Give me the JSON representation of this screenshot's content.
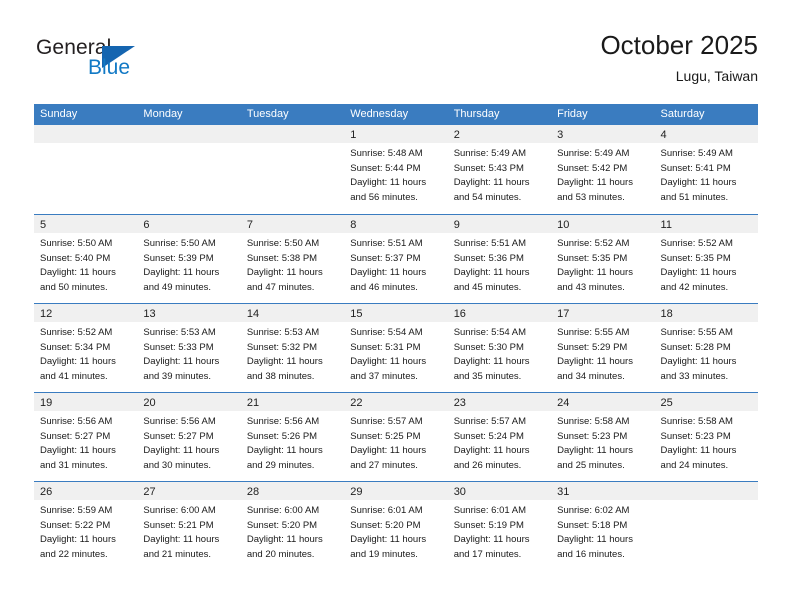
{
  "logo": {
    "word_top": "General",
    "word_bottom": "Blue",
    "accent_color": "#1565b0",
    "text_color": "#231f20"
  },
  "header": {
    "title": "October 2025",
    "subtitle": "Lugu, Taiwan"
  },
  "theme": {
    "header_row_bg": "#3a7cc0",
    "header_row_text": "#ffffff",
    "day_head_bg": "#f0f0f0",
    "row_divider": "#3a7cc0"
  },
  "weekday_headers": [
    "Sunday",
    "Monday",
    "Tuesday",
    "Wednesday",
    "Thursday",
    "Friday",
    "Saturday"
  ],
  "weeks": [
    [
      {
        "day": "",
        "sunrise": "",
        "sunset": "",
        "daylight_1": "",
        "daylight_2": "",
        "empty": true
      },
      {
        "day": "",
        "sunrise": "",
        "sunset": "",
        "daylight_1": "",
        "daylight_2": "",
        "empty": true
      },
      {
        "day": "",
        "sunrise": "",
        "sunset": "",
        "daylight_1": "",
        "daylight_2": "",
        "empty": true
      },
      {
        "day": "1",
        "sunrise": "Sunrise: 5:48 AM",
        "sunset": "Sunset: 5:44 PM",
        "daylight_1": "Daylight: 11 hours",
        "daylight_2": "and 56 minutes."
      },
      {
        "day": "2",
        "sunrise": "Sunrise: 5:49 AM",
        "sunset": "Sunset: 5:43 PM",
        "daylight_1": "Daylight: 11 hours",
        "daylight_2": "and 54 minutes."
      },
      {
        "day": "3",
        "sunrise": "Sunrise: 5:49 AM",
        "sunset": "Sunset: 5:42 PM",
        "daylight_1": "Daylight: 11 hours",
        "daylight_2": "and 53 minutes."
      },
      {
        "day": "4",
        "sunrise": "Sunrise: 5:49 AM",
        "sunset": "Sunset: 5:41 PM",
        "daylight_1": "Daylight: 11 hours",
        "daylight_2": "and 51 minutes."
      }
    ],
    [
      {
        "day": "5",
        "sunrise": "Sunrise: 5:50 AM",
        "sunset": "Sunset: 5:40 PM",
        "daylight_1": "Daylight: 11 hours",
        "daylight_2": "and 50 minutes."
      },
      {
        "day": "6",
        "sunrise": "Sunrise: 5:50 AM",
        "sunset": "Sunset: 5:39 PM",
        "daylight_1": "Daylight: 11 hours",
        "daylight_2": "and 49 minutes."
      },
      {
        "day": "7",
        "sunrise": "Sunrise: 5:50 AM",
        "sunset": "Sunset: 5:38 PM",
        "daylight_1": "Daylight: 11 hours",
        "daylight_2": "and 47 minutes."
      },
      {
        "day": "8",
        "sunrise": "Sunrise: 5:51 AM",
        "sunset": "Sunset: 5:37 PM",
        "daylight_1": "Daylight: 11 hours",
        "daylight_2": "and 46 minutes."
      },
      {
        "day": "9",
        "sunrise": "Sunrise: 5:51 AM",
        "sunset": "Sunset: 5:36 PM",
        "daylight_1": "Daylight: 11 hours",
        "daylight_2": "and 45 minutes."
      },
      {
        "day": "10",
        "sunrise": "Sunrise: 5:52 AM",
        "sunset": "Sunset: 5:35 PM",
        "daylight_1": "Daylight: 11 hours",
        "daylight_2": "and 43 minutes."
      },
      {
        "day": "11",
        "sunrise": "Sunrise: 5:52 AM",
        "sunset": "Sunset: 5:35 PM",
        "daylight_1": "Daylight: 11 hours",
        "daylight_2": "and 42 minutes."
      }
    ],
    [
      {
        "day": "12",
        "sunrise": "Sunrise: 5:52 AM",
        "sunset": "Sunset: 5:34 PM",
        "daylight_1": "Daylight: 11 hours",
        "daylight_2": "and 41 minutes."
      },
      {
        "day": "13",
        "sunrise": "Sunrise: 5:53 AM",
        "sunset": "Sunset: 5:33 PM",
        "daylight_1": "Daylight: 11 hours",
        "daylight_2": "and 39 minutes."
      },
      {
        "day": "14",
        "sunrise": "Sunrise: 5:53 AM",
        "sunset": "Sunset: 5:32 PM",
        "daylight_1": "Daylight: 11 hours",
        "daylight_2": "and 38 minutes."
      },
      {
        "day": "15",
        "sunrise": "Sunrise: 5:54 AM",
        "sunset": "Sunset: 5:31 PM",
        "daylight_1": "Daylight: 11 hours",
        "daylight_2": "and 37 minutes."
      },
      {
        "day": "16",
        "sunrise": "Sunrise: 5:54 AM",
        "sunset": "Sunset: 5:30 PM",
        "daylight_1": "Daylight: 11 hours",
        "daylight_2": "and 35 minutes."
      },
      {
        "day": "17",
        "sunrise": "Sunrise: 5:55 AM",
        "sunset": "Sunset: 5:29 PM",
        "daylight_1": "Daylight: 11 hours",
        "daylight_2": "and 34 minutes."
      },
      {
        "day": "18",
        "sunrise": "Sunrise: 5:55 AM",
        "sunset": "Sunset: 5:28 PM",
        "daylight_1": "Daylight: 11 hours",
        "daylight_2": "and 33 minutes."
      }
    ],
    [
      {
        "day": "19",
        "sunrise": "Sunrise: 5:56 AM",
        "sunset": "Sunset: 5:27 PM",
        "daylight_1": "Daylight: 11 hours",
        "daylight_2": "and 31 minutes."
      },
      {
        "day": "20",
        "sunrise": "Sunrise: 5:56 AM",
        "sunset": "Sunset: 5:27 PM",
        "daylight_1": "Daylight: 11 hours",
        "daylight_2": "and 30 minutes."
      },
      {
        "day": "21",
        "sunrise": "Sunrise: 5:56 AM",
        "sunset": "Sunset: 5:26 PM",
        "daylight_1": "Daylight: 11 hours",
        "daylight_2": "and 29 minutes."
      },
      {
        "day": "22",
        "sunrise": "Sunrise: 5:57 AM",
        "sunset": "Sunset: 5:25 PM",
        "daylight_1": "Daylight: 11 hours",
        "daylight_2": "and 27 minutes."
      },
      {
        "day": "23",
        "sunrise": "Sunrise: 5:57 AM",
        "sunset": "Sunset: 5:24 PM",
        "daylight_1": "Daylight: 11 hours",
        "daylight_2": "and 26 minutes."
      },
      {
        "day": "24",
        "sunrise": "Sunrise: 5:58 AM",
        "sunset": "Sunset: 5:23 PM",
        "daylight_1": "Daylight: 11 hours",
        "daylight_2": "and 25 minutes."
      },
      {
        "day": "25",
        "sunrise": "Sunrise: 5:58 AM",
        "sunset": "Sunset: 5:23 PM",
        "daylight_1": "Daylight: 11 hours",
        "daylight_2": "and 24 minutes."
      }
    ],
    [
      {
        "day": "26",
        "sunrise": "Sunrise: 5:59 AM",
        "sunset": "Sunset: 5:22 PM",
        "daylight_1": "Daylight: 11 hours",
        "daylight_2": "and 22 minutes."
      },
      {
        "day": "27",
        "sunrise": "Sunrise: 6:00 AM",
        "sunset": "Sunset: 5:21 PM",
        "daylight_1": "Daylight: 11 hours",
        "daylight_2": "and 21 minutes."
      },
      {
        "day": "28",
        "sunrise": "Sunrise: 6:00 AM",
        "sunset": "Sunset: 5:20 PM",
        "daylight_1": "Daylight: 11 hours",
        "daylight_2": "and 20 minutes."
      },
      {
        "day": "29",
        "sunrise": "Sunrise: 6:01 AM",
        "sunset": "Sunset: 5:20 PM",
        "daylight_1": "Daylight: 11 hours",
        "daylight_2": "and 19 minutes."
      },
      {
        "day": "30",
        "sunrise": "Sunrise: 6:01 AM",
        "sunset": "Sunset: 5:19 PM",
        "daylight_1": "Daylight: 11 hours",
        "daylight_2": "and 17 minutes."
      },
      {
        "day": "31",
        "sunrise": "Sunrise: 6:02 AM",
        "sunset": "Sunset: 5:18 PM",
        "daylight_1": "Daylight: 11 hours",
        "daylight_2": "and 16 minutes."
      },
      {
        "day": "",
        "sunrise": "",
        "sunset": "",
        "daylight_1": "",
        "daylight_2": "",
        "empty": true
      }
    ]
  ]
}
